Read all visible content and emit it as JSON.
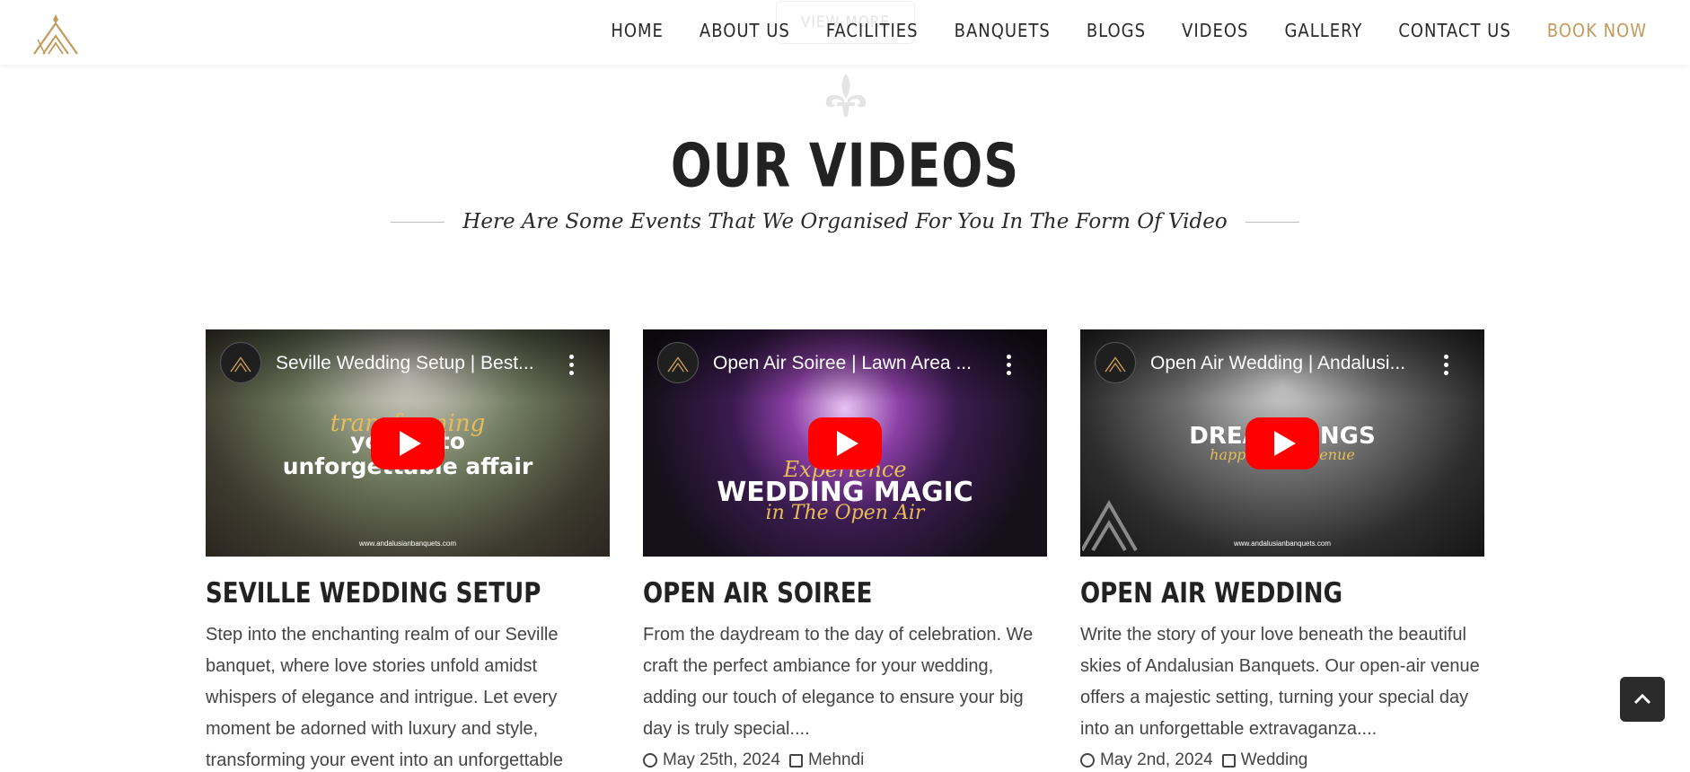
{
  "header": {
    "ghost_button_label": "VIEW MORE",
    "nav": [
      {
        "label": "HOME"
      },
      {
        "label": "ABOUT US"
      },
      {
        "label": "FACILITIES"
      },
      {
        "label": "BANQUETS"
      },
      {
        "label": "BLOGS"
      },
      {
        "label": "VIDEOS"
      },
      {
        "label": "GALLERY"
      },
      {
        "label": "CONTACT US"
      },
      {
        "label": "BOOK NOW"
      }
    ],
    "accent_color": "#c49a5a"
  },
  "section": {
    "title": "OUR VIDEOS",
    "subtitle": "Here Are Some Events That We Organised For You In The Form Of Video"
  },
  "videos": [
    {
      "embed_title": "Seville Wedding Setup | Best...",
      "overlay_script": "transforming",
      "overlay_line1": "your      into",
      "overlay_line2": "unforgettable affair",
      "url": "www.andalusianbanquets.com",
      "title": "SEVILLE WEDDING SETUP",
      "description": "Step into the enchanting realm of our Seville banquet, where love stories unfold amidst whispers of elegance and intrigue. Let every moment be adorned with luxury and style, transforming your event into an unforgettable",
      "date": "",
      "category": ""
    },
    {
      "embed_title": "Open Air Soiree | Lawn Area ...",
      "overlay_script": "Experience",
      "overlay_line1": "WEDDING MAGIC",
      "overlay_script2": "in The Open Air",
      "title": "OPEN AIR SOIREE",
      "description": "From the daydream to the day of celebration. We craft the perfect ambiance for your wedding, adding our touch of elegance to ensure your big day is truly special....",
      "date": "May 25th, 2024",
      "category": "Mehndi"
    },
    {
      "embed_title": "Open Air Wedding | Andalusi...",
      "overlay_line1": "DREAM      DINGS",
      "overlay_script": "happen in       air venue",
      "url": "www.andalusianbanquets.com",
      "title": "OPEN AIR WEDDING",
      "description": "Write the story of your love beneath the beautiful skies of Andalusian Banquets. Our open-air venue offers a majestic setting, turning your special day into an unforgettable extravaganza....",
      "date": "May 2nd, 2024",
      "category": "Wedding"
    }
  ]
}
